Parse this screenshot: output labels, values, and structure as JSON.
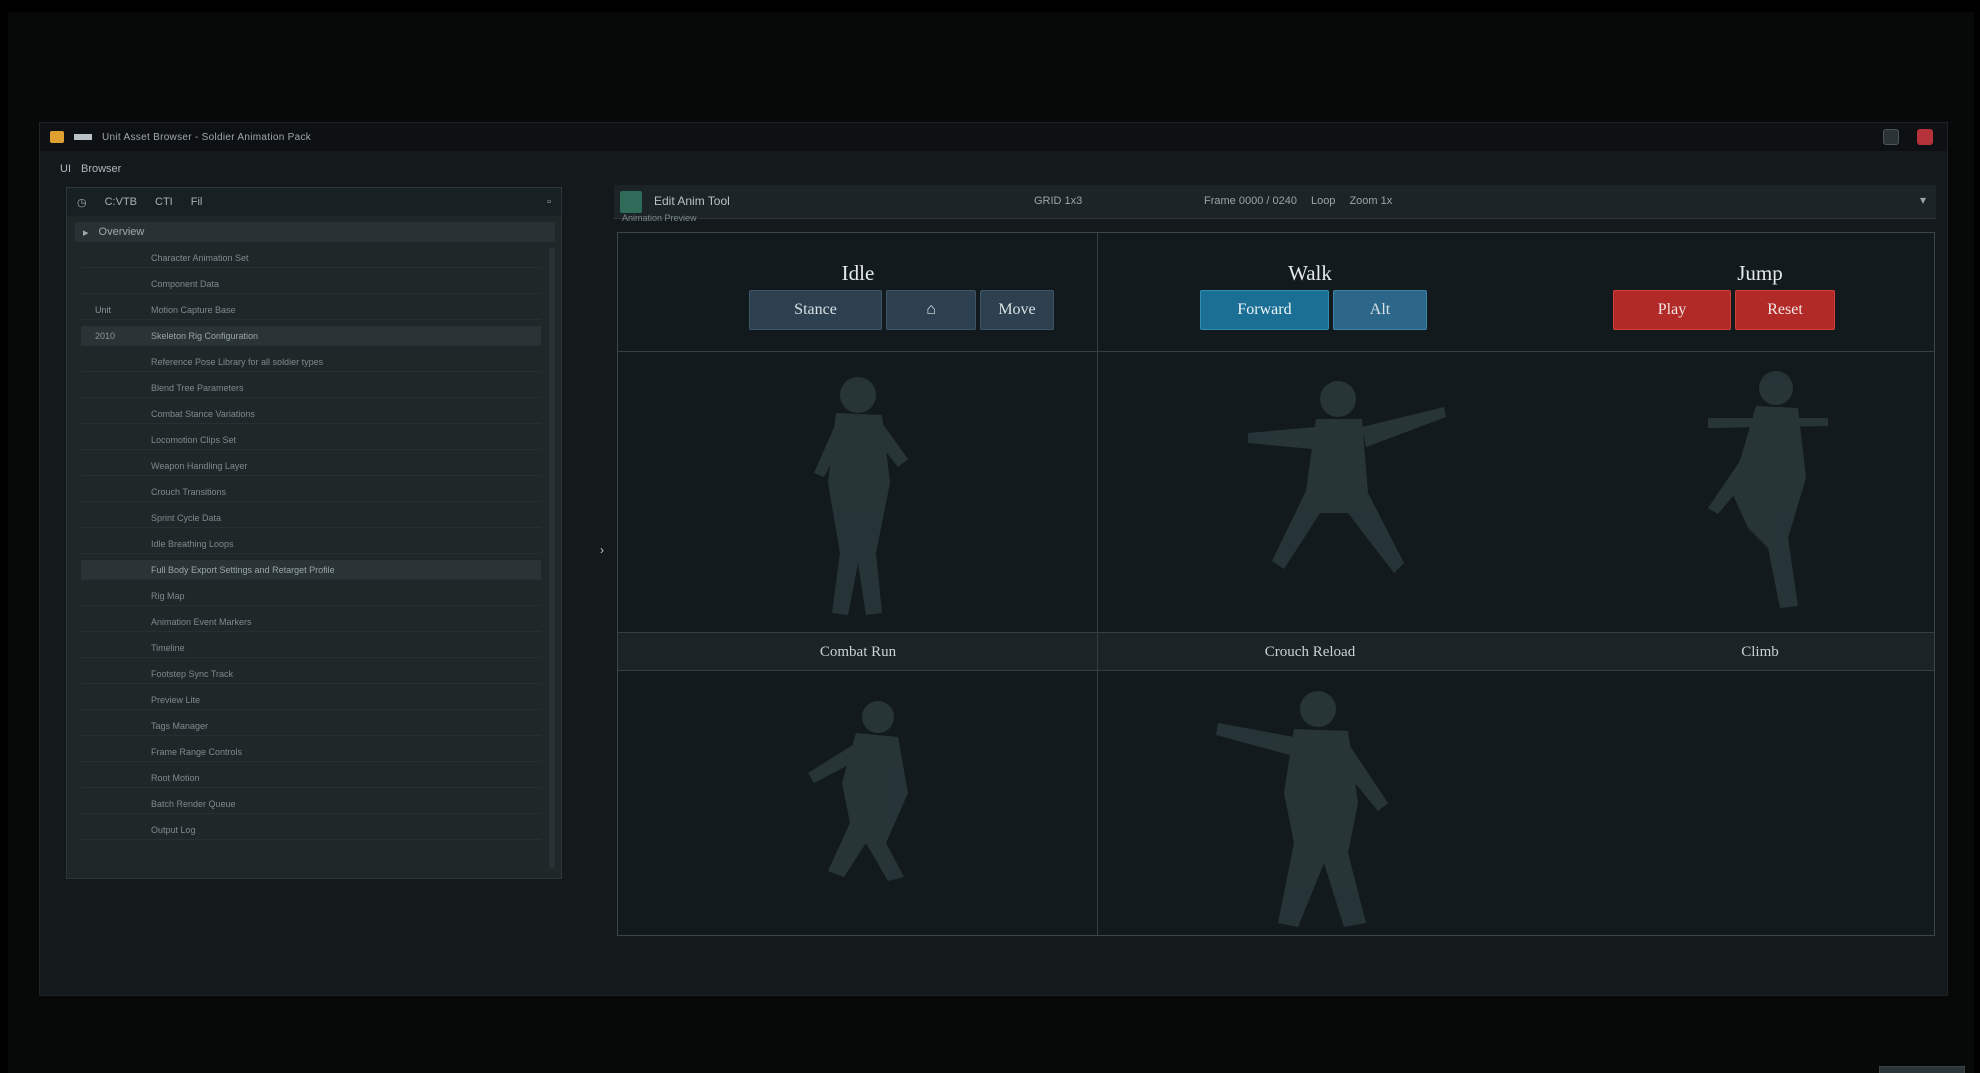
{
  "window": {
    "title": "Unit Asset Browser - Soldier Animation Pack",
    "menu": [
      "UI",
      "Browser"
    ]
  },
  "left_panel": {
    "toolbar": [
      "C:VTB",
      "CTI",
      "Fil"
    ],
    "header": "Overview",
    "rows": [
      {
        "gutter": "",
        "text": "Character Animation Set"
      },
      {
        "gutter": "",
        "text": "Component Data"
      },
      {
        "gutter": "Unit",
        "text": "Motion Capture Base"
      },
      {
        "gutter": "2010",
        "text": "Skeleton Rig Configuration",
        "selected": true
      },
      {
        "gutter": "",
        "text": "Reference Pose Library for all soldier types"
      },
      {
        "gutter": "",
        "text": "Blend Tree Parameters"
      },
      {
        "gutter": "",
        "text": "Combat Stance Variations"
      },
      {
        "gutter": "",
        "text": "Locomotion Clips Set"
      },
      {
        "gutter": "",
        "text": "Weapon Handling Layer"
      },
      {
        "gutter": "",
        "text": "Crouch Transitions"
      },
      {
        "gutter": "",
        "text": "Sprint Cycle Data"
      },
      {
        "gutter": "",
        "text": "Idle Breathing Loops"
      },
      {
        "gutter": "",
        "text": "Full Body Export Settings and Retarget Profile",
        "selected": true
      },
      {
        "gutter": "",
        "text": "Rig Map"
      },
      {
        "gutter": "",
        "text": "Animation Event Markers"
      },
      {
        "gutter": "",
        "text": "Timeline"
      },
      {
        "gutter": "",
        "text": "Footstep Sync Track"
      },
      {
        "gutter": "",
        "text": "Preview Lite"
      },
      {
        "gutter": "",
        "text": "Tags Manager"
      },
      {
        "gutter": "",
        "text": "Frame Range Controls"
      },
      {
        "gutter": "",
        "text": "Root Motion"
      },
      {
        "gutter": "",
        "text": "Batch Render Queue"
      },
      {
        "gutter": "",
        "text": "Output Log"
      }
    ]
  },
  "right_panel": {
    "header_title": "Edit Anim Tool",
    "subtitle": "Animation Preview",
    "status": "GRID 1x3",
    "info": [
      "Frame 0000 / 0240",
      "Loop",
      "Zoom 1x"
    ],
    "columns": [
      {
        "title": "Idle",
        "buttons": [
          "Stance",
          "⌂",
          "Move"
        ]
      },
      {
        "title": "Walk",
        "buttons": [
          "Forward",
          "Alt"
        ]
      },
      {
        "title": "Jump",
        "buttons": [
          "Play",
          "Reset"
        ]
      }
    ],
    "captions": [
      "Combat Run",
      "Crouch Reload",
      "Climb"
    ]
  },
  "footer": {
    "button": "— ◆ —"
  },
  "colors": {
    "accent_blue": "#1b6f95",
    "accent_red": "#b22a28",
    "panel_bg": "#141a1c"
  }
}
